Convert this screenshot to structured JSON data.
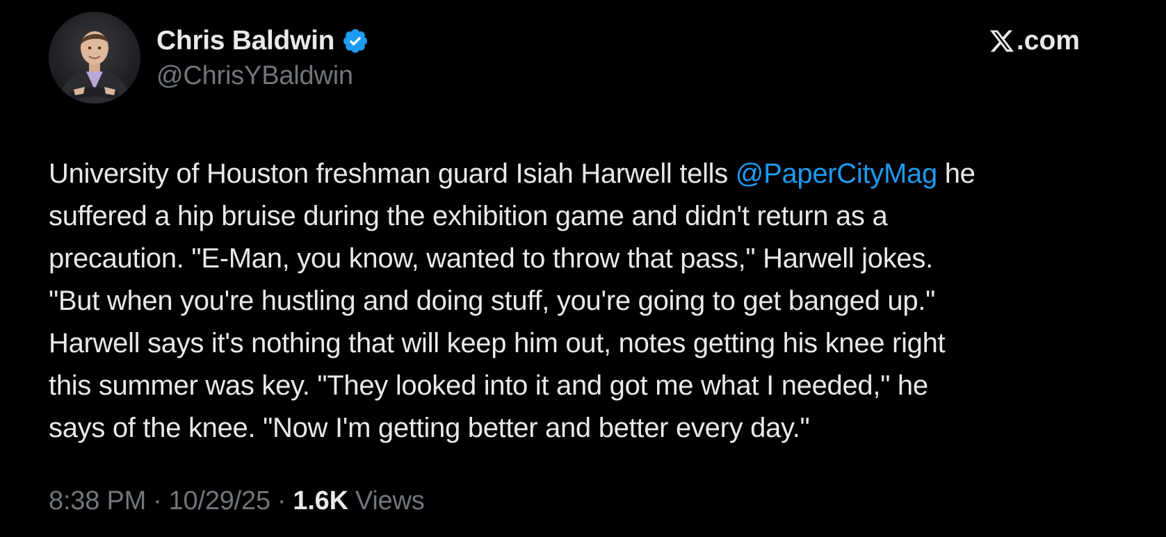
{
  "author": {
    "display_name": "Chris Baldwin",
    "handle": "@ChrisYBaldwin",
    "verified": true,
    "avatar_icon": "profile-photo-icon"
  },
  "site": {
    "label": ".com",
    "logo_icon": "x-logo-icon"
  },
  "tweet": {
    "lines": [
      {
        "before": "University of Houston freshman guard Isiah Harwell tells ",
        "mention": "@PaperCityMag",
        "after": " he"
      },
      {
        "text": "suffered a hip bruise during the exhibition game and didn't return as a"
      },
      {
        "text": "precaution. \"E-Man, you know, wanted to throw that pass,\" Harwell jokes."
      },
      {
        "text": "\"But when you're hustling and doing stuff, you're going to get banged up.\""
      },
      {
        "text": "Harwell says it's nothing that will keep him out, notes getting his knee right"
      },
      {
        "text": "this summer was key. \"They looked into it and got me what I needed,\" he"
      },
      {
        "text": "says of the knee. \"Now I'm getting better and better every day.\""
      }
    ]
  },
  "meta": {
    "time": "8:38 PM",
    "separator": "·",
    "date": "10/29/25",
    "views_count": "1.6K",
    "views_label": "Views"
  },
  "colors": {
    "background": "#000000",
    "text": "#e7e9ea",
    "muted": "#71767b",
    "link": "#1d9bf0",
    "verified": "#1d9bf0"
  }
}
